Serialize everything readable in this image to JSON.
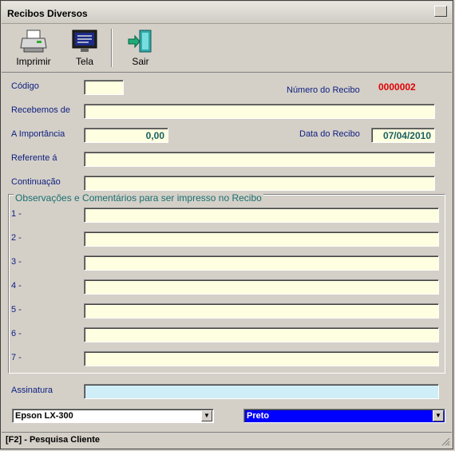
{
  "window": {
    "title": "Recibos Diversos"
  },
  "toolbar": {
    "print_label": "Imprimir",
    "screen_label": "Tela",
    "exit_label": "Sair"
  },
  "form": {
    "codigo_label": "Código",
    "codigo_value": "",
    "numero_recibo_label": "Número do Recibo",
    "numero_recibo_value": "0000002",
    "recebemos_label": "Recebemos de",
    "recebemos_value": "",
    "importancia_label": "A Importância",
    "importancia_value": "0,00",
    "data_recibo_label": "Data do Recibo",
    "data_recibo_value": "07/04/2010",
    "referente_label": "Referente á",
    "referente_value": "",
    "continuacao_label": "Continuação",
    "continuacao_value": ""
  },
  "observacoes": {
    "title": "Observações e Comentários para ser impresso no Recibo",
    "lines": [
      {
        "label": "1 -",
        "value": ""
      },
      {
        "label": "2 -",
        "value": ""
      },
      {
        "label": "3 -",
        "value": ""
      },
      {
        "label": "4 -",
        "value": ""
      },
      {
        "label": "5 -",
        "value": ""
      },
      {
        "label": "6 -",
        "value": ""
      },
      {
        "label": "7 -",
        "value": ""
      }
    ]
  },
  "assinatura": {
    "label": "Assinatura",
    "value": ""
  },
  "printer_select": {
    "value": "Epson LX-300"
  },
  "color_select": {
    "value": "Preto",
    "bg": "#0000ff"
  },
  "status": {
    "text": "[F2] - Pesquisa Cliente"
  }
}
